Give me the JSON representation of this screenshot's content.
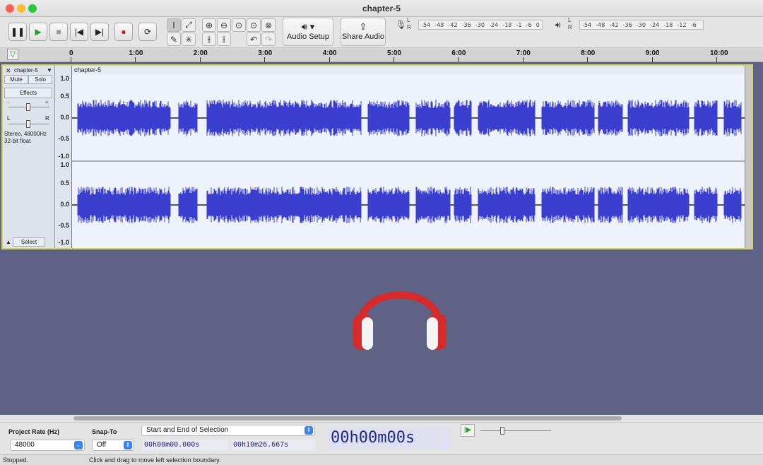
{
  "window": {
    "title": "chapter-5",
    "traffic_lights": {
      "close": "#ff5f57",
      "minimize": "#febc2e",
      "zoom": "#28c840"
    }
  },
  "toolbar": {
    "audio_setup_label": "Audio Setup",
    "share_audio_label": "Share Audio",
    "rec_meter_ticks": [
      "-54",
      "-48",
      "-42",
      "-36",
      "-30",
      "-24",
      "-18",
      "-1",
      "-6",
      "0"
    ],
    "play_meter_ticks": [
      "-54",
      "-48",
      "-42",
      "-36",
      "-30",
      "-24",
      "-18",
      "-12",
      "-6",
      ""
    ],
    "meter_lr": [
      "L",
      "R"
    ]
  },
  "ruler": {
    "ticks": [
      "0",
      "1:00",
      "2:00",
      "3:00",
      "4:00",
      "5:00",
      "6:00",
      "7:00",
      "8:00",
      "9:00",
      "10:00"
    ]
  },
  "track": {
    "name": "chapter-5",
    "clip_name": "chapter-5",
    "mute_label": "Mute",
    "solo_label": "Solo",
    "effects_label": "Effects",
    "gain_minus": "-",
    "gain_plus": "+",
    "pan_left": "L",
    "pan_right": "R",
    "format_line1": "Stereo, 48000Hz",
    "format_line2": "32-bit float",
    "select_label": "Select",
    "vruler_labels": [
      "1.0",
      "0.5",
      "0.0",
      "-0.5",
      "-1.0"
    ],
    "wave_color": "#3b3fcf",
    "selection_border_color": "#d7d54b"
  },
  "selection_toolbar": {
    "project_rate_label": "Project Rate (Hz)",
    "project_rate_value": "48000",
    "snap_to_label": "Snap-To",
    "snap_to_value": "Off",
    "selection_mode": "Start and End of Selection",
    "start_time": "00h00m00.000s",
    "end_time": "00h10m26.667s",
    "audio_position": "00h00m00s"
  },
  "status": {
    "state": "Stopped.",
    "hint": "Click and drag to move left selection boundary."
  }
}
